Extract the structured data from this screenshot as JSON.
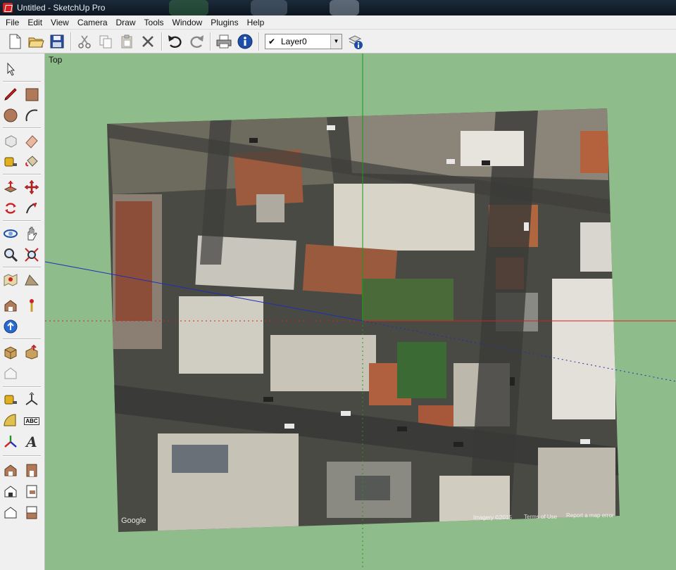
{
  "window": {
    "title": "Untitled - SketchUp Pro"
  },
  "menu": [
    "File",
    "Edit",
    "View",
    "Camera",
    "Draw",
    "Tools",
    "Window",
    "Plugins",
    "Help"
  ],
  "toolbar": {
    "layer": {
      "checked": "✔",
      "value": "Layer0",
      "arrow": "▼"
    }
  },
  "viewport": {
    "label": "Top",
    "image_credit": "Google",
    "attribution": {
      "imagery": "Imagery ©2015",
      "terms": "Terms of Use",
      "report": "Report a map error"
    }
  },
  "palette_labels": {
    "text_tool": "ABC",
    "3d_text": "A"
  },
  "colors": {
    "ground": "#8fbc8b",
    "axis_red": "#d42020",
    "axis_green": "#1a9a1a",
    "axis_blue": "#1c2fb8"
  }
}
